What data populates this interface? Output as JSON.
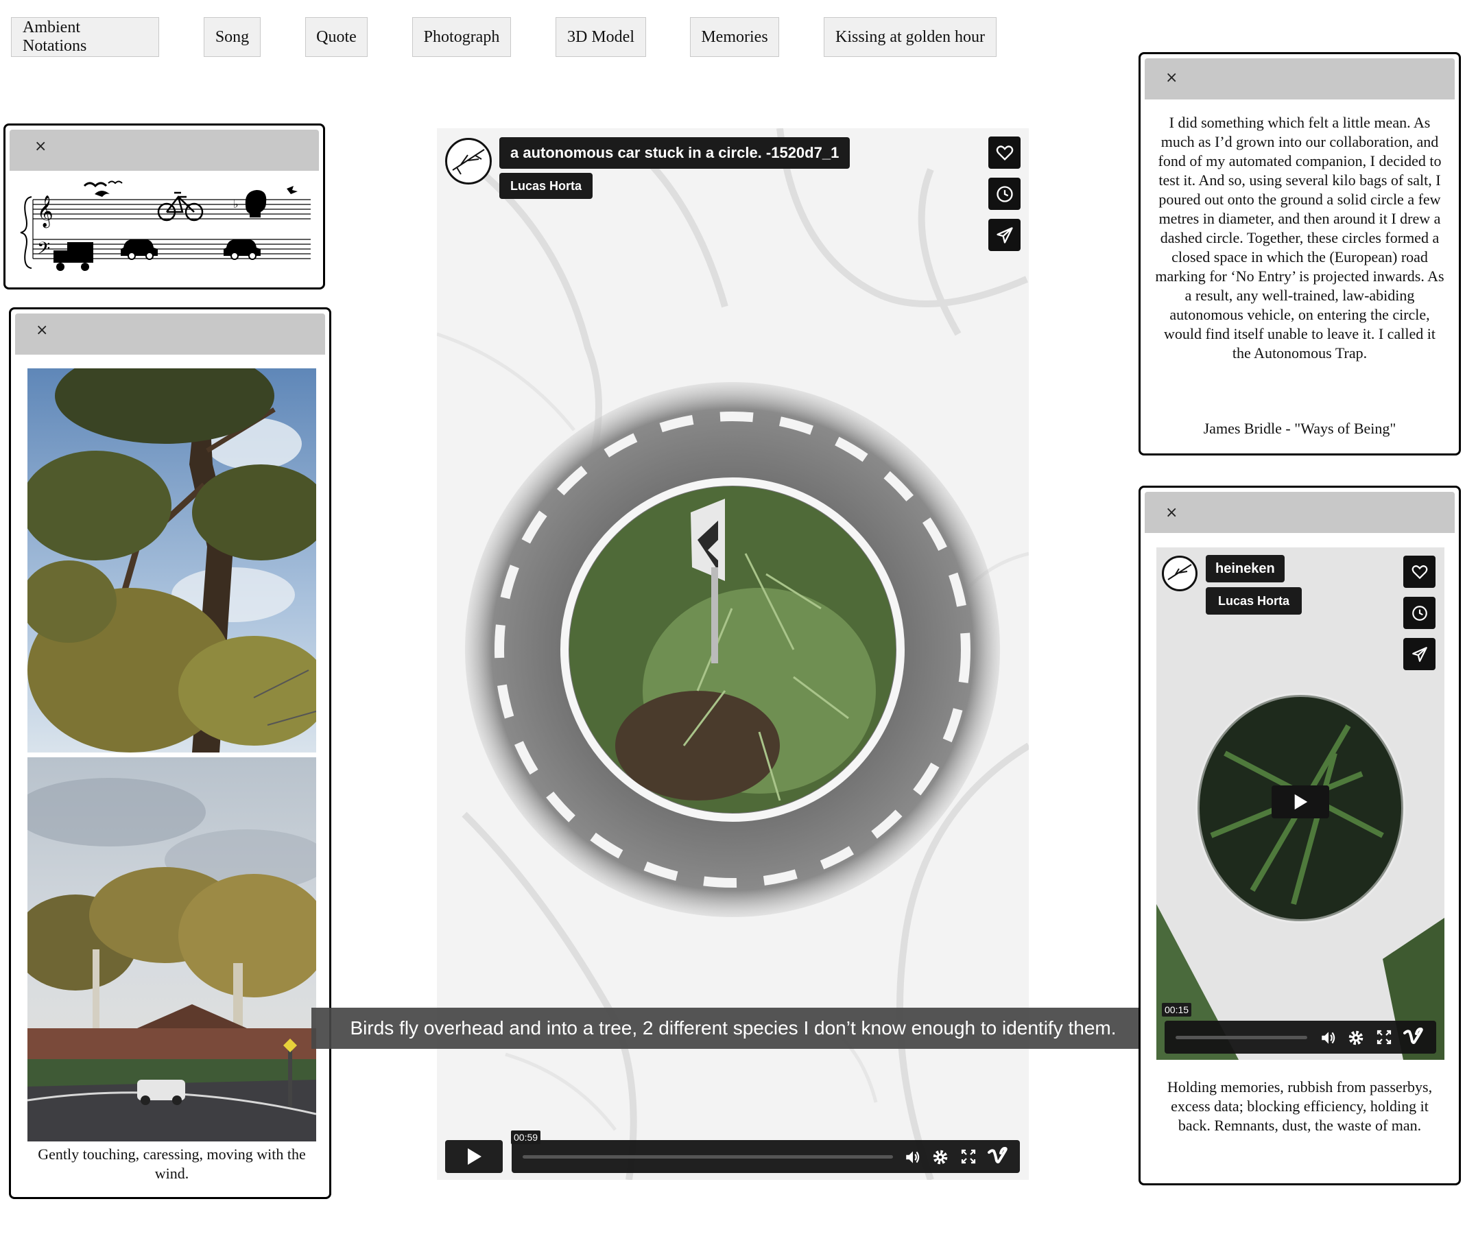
{
  "nav": [
    {
      "label": "Ambient Notations"
    },
    {
      "label": "Song"
    },
    {
      "label": "Quote"
    },
    {
      "label": "Photograph"
    },
    {
      "label": "3D Model"
    },
    {
      "label": "Memories"
    },
    {
      "label": "Kissing at golden hour"
    }
  ],
  "close_glyph": "×",
  "photo_window": {
    "caption": "Gently touching, caressing, moving with the wind."
  },
  "quote_window": {
    "text": "I did something which felt a little mean. As much as I’d grown into our collaboration, and fond of my automated companion, I decided to test it. And so, using several kilo bags of salt, I poured out onto the ground a solid circle a few metres in diameter, and then around it I drew a dashed circle. Together, these circles formed a closed space in which the (European) road marking for ‘No Entry’ is projected inwards. As a result, any well-trained, law-abiding autonomous vehicle, on entering the circle, would find itself unable to leave it. I called it the Autonomous Trap.",
    "attribution": "James Bridle - \"Ways of Being\""
  },
  "main_video": {
    "title": "a autonomous car stuck in a circle. -1520d7_1",
    "author": "Lucas Horta",
    "time": "00:59",
    "progress": 0.0
  },
  "subtitle": "Birds fly overhead and into a tree, 2 different species I don’t know enough to identify them.",
  "side_video": {
    "title": "heineken",
    "author": "Lucas Horta",
    "time": "00:15",
    "progress": 0.0,
    "caption": "Holding memories, rubbish from passerbys, excess data; blocking efficiency, holding it back. Remnants, dust, the waste of man."
  },
  "colors": {
    "titlebar": "#c8c8c8",
    "player_dark": "#141414",
    "subtitle_bg": "#505050"
  }
}
